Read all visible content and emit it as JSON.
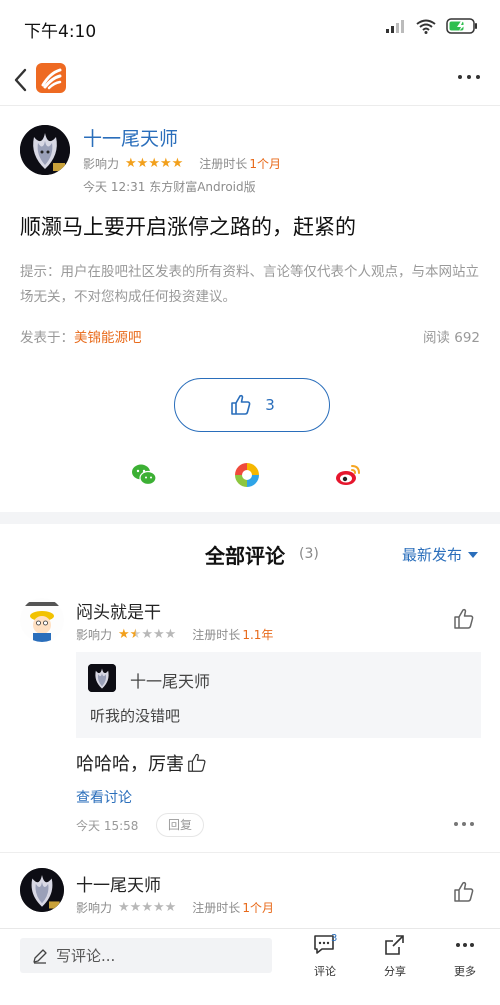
{
  "status_bar": {
    "time": "下午4:10"
  },
  "post": {
    "author": "十一尾天师",
    "influence_label": "影响力",
    "influence_stars": 5,
    "reg_label": "注册时长",
    "reg_value": "1个月",
    "time_source": "今天 12:31 东方财富Android版",
    "title": "顺灏马上要开启涨停之路的，赶紧的",
    "disclaimer": "提示：用户在股吧社区发表的所有资料、言论等仅代表个人观点，与本网站立场无关，不对您构成任何投资建议。",
    "posted_in_label": "发表于：",
    "bar_name": "美锦能源吧",
    "read_label": "阅读 692",
    "like_count": "3"
  },
  "comments_header": {
    "title": "全部评论",
    "count": "(3)",
    "sort_label": "最新发布"
  },
  "comments": [
    {
      "name": "闷头就是干",
      "influence_label": "影响力",
      "influence_stars": 1.5,
      "reg_label": "注册时长",
      "reg_value": "1.1年",
      "quote_name": "十一尾天师",
      "quote_text": "听我的没错吧",
      "text": "哈哈哈，厉害",
      "view_discussion": "查看讨论",
      "time": "今天 15:58",
      "reply_label": "回复"
    },
    {
      "name": "十一尾天师",
      "influence_label": "影响力",
      "influence_stars": 0,
      "reg_label": "注册时长",
      "reg_value": "1个月"
    }
  ],
  "bottom_bar": {
    "write_placeholder": "写评论...",
    "comment_label": "评论",
    "comment_badge": "3",
    "share_label": "分享",
    "more_label": "更多"
  },
  "colors": {
    "accent_blue": "#2a6ebb",
    "accent_orange": "#e86a1a",
    "star_gold": "#f2a01c"
  }
}
